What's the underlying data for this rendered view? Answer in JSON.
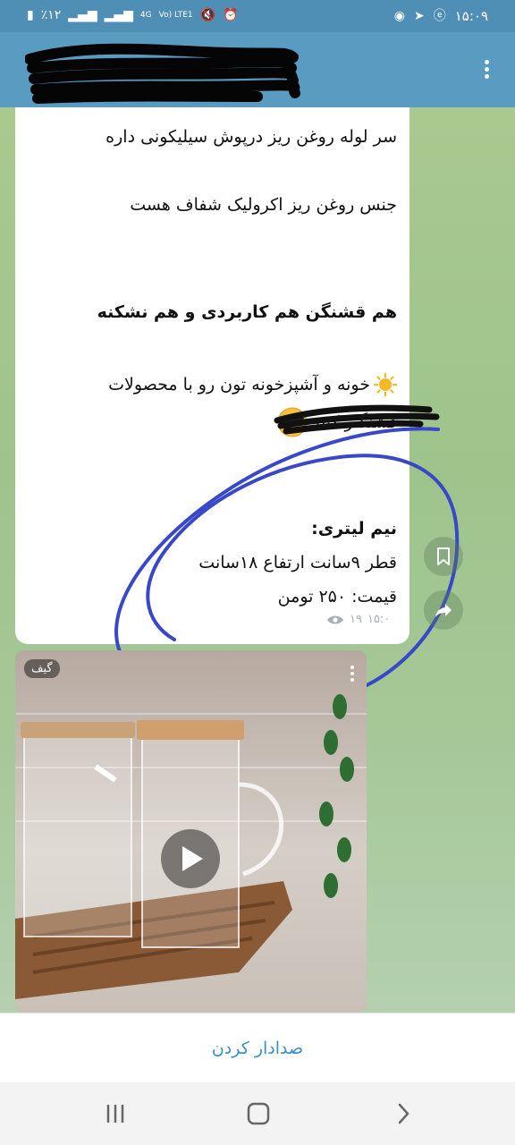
{
  "status_bar": {
    "time": "۱۵:۰۹",
    "battery": "٪۱۲",
    "network_label": "4G",
    "lte_label": "Vo) LTE1"
  },
  "header": {
    "title_redacted": true
  },
  "message": {
    "lines": [
      "سر لوله روغن ریز درپوش سیلیکونی داره",
      "جنس روغن ریز اکرولیک شفاف هست",
      "هم قشنگن هم کاربردی و هم نشکنه",
      "خونه و آشپزخونه تون رو با محصولات",
      "قشنگتر کنید",
      "نیم لیتری:",
      "قطر ۹سانت ارتفاع ۱۸سانت",
      "قیمت: ۲۵۰ تومن"
    ],
    "views": "۱۹",
    "time": "۱۵:۰"
  },
  "media": {
    "badge": "گیف"
  },
  "unmute": {
    "label": "صدادار کردن"
  },
  "colors": {
    "header": "#5a9bc2",
    "accent": "#3a8fc9",
    "annotation": "#3848c8"
  },
  "icons": [
    "battery-icon",
    "signal-icon",
    "mute-icon",
    "alarm-icon",
    "chrome-icon",
    "telegram-icon",
    "edge-icon",
    "menu-icon",
    "eye-icon",
    "bookmark-icon",
    "share-icon",
    "play-icon",
    "recent-apps-icon",
    "home-icon",
    "back-icon"
  ]
}
